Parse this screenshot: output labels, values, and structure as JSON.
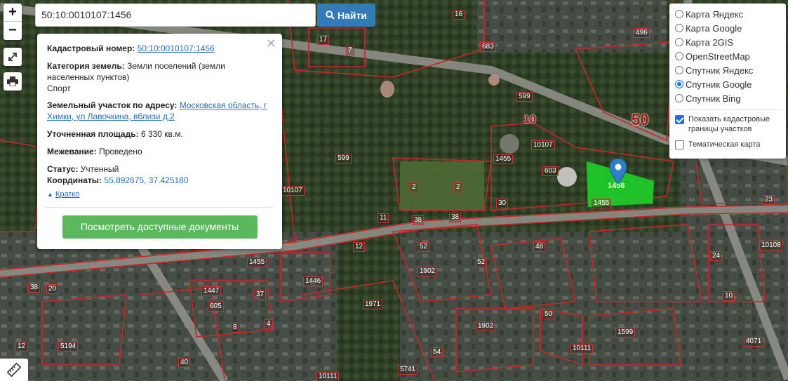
{
  "search": {
    "value": "50:10:0010107:1456",
    "button_label": "Найти"
  },
  "zoom": {
    "plus": "+",
    "minus": "−"
  },
  "info": {
    "cadastral_label": "Кадастровый номер:",
    "cadastral_value": "50:10:0010107:1456",
    "category_label": "Категория земель:",
    "category_value": "Земли поселений (земли населенных пунктов)",
    "usage_value": "Спорт",
    "address_label": "Земельный участок по адресу:",
    "address_value": "Московская область, г Химки, ул Лавочкина, вблизи д.2",
    "area_label": "Уточненная площадь:",
    "area_value": "6 330 кв.м.",
    "survey_label": "Межевание:",
    "survey_value": "Проведено",
    "status_label": "Статус:",
    "status_value": "Учтенный",
    "coords_label": "Координаты:",
    "coords_value": "55.892675, 37.425180",
    "brief_label": "Кратко",
    "docs_button": "Посмотреть доступные документы"
  },
  "layers": {
    "options": [
      {
        "label": "Карта Яндекс",
        "selected": false
      },
      {
        "label": "Карта Google",
        "selected": false
      },
      {
        "label": "Карта 2GIS",
        "selected": false
      },
      {
        "label": "OpenStreetMap",
        "selected": false
      },
      {
        "label": "Спутник Яндекс",
        "selected": false
      },
      {
        "label": "Спутник Google",
        "selected": true
      },
      {
        "label": "Спутник Bing",
        "selected": false
      }
    ],
    "show_borders_label": "Показать кадастровые границы участков",
    "show_borders_checked": true,
    "thematic_label": "Тематическая карта",
    "thematic_checked": false
  },
  "map": {
    "labels": [
      "16",
      "17",
      "7",
      "683",
      "496",
      "599",
      "10",
      "10107",
      "50",
      "1455",
      "603",
      "2",
      "2",
      "30",
      "38",
      "38",
      "1455",
      "599",
      "11",
      "12",
      "52",
      "48",
      "52",
      "1902",
      "1455",
      "1446",
      "1447",
      "37",
      "605",
      "8",
      "4",
      "1971",
      "24",
      "23",
      "10108",
      "1902",
      "50",
      "1599",
      "10111",
      "10",
      "4071",
      "5194",
      "12",
      "20",
      "38",
      "40",
      "54",
      "5741",
      "10111",
      "10107",
      "1456"
    ],
    "parcel_label": "1456",
    "colors": {
      "border": "#c62828",
      "parcel": "#1fd12a",
      "marker": "#2d7fc7"
    }
  }
}
